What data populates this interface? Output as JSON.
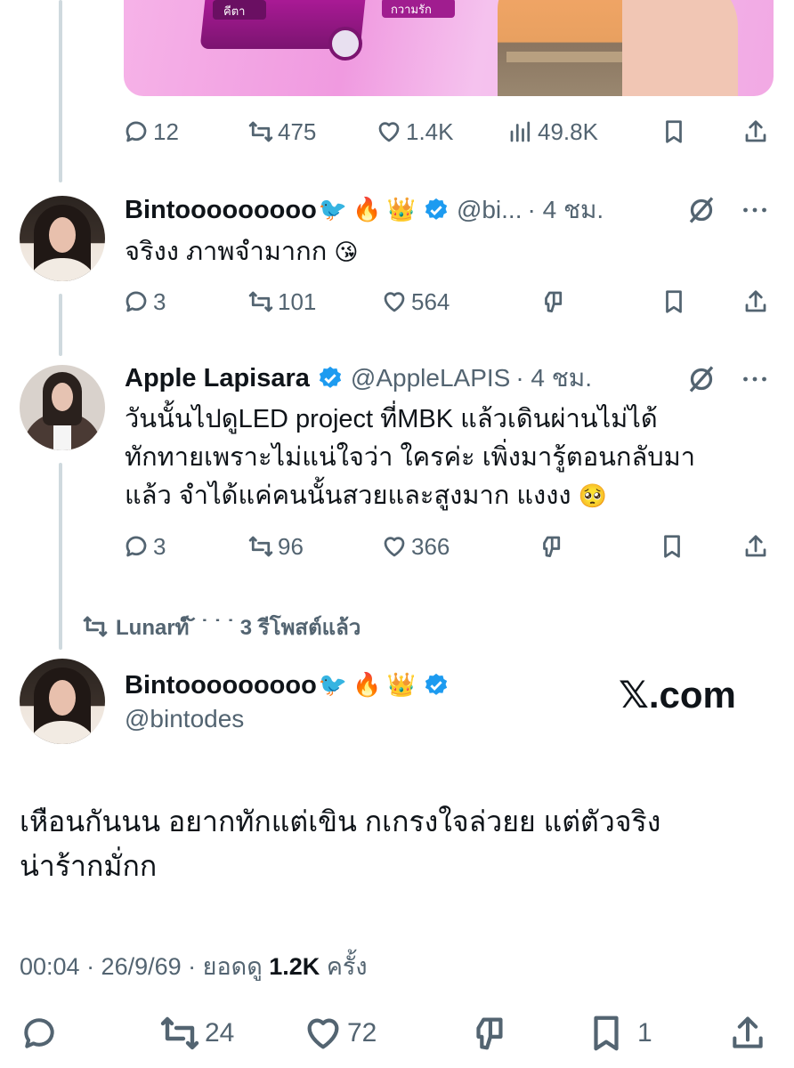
{
  "top_tweet": {
    "stats": {
      "replies": "12",
      "reposts": "475",
      "likes": "1.4K",
      "views": "49.8K"
    },
    "media_text": {
      "tag1": "คีตา",
      "tag2": "กวามรัก"
    }
  },
  "reply_bin": {
    "name": "Bintooooooooo",
    "emoji_1": "🐦",
    "emoji_2": "🔥",
    "emoji_3": "👑",
    "handle": "@bi...",
    "time": "· 4 ชม.",
    "text": "จริงง ภาพจำมากก",
    "text_emoji": "😘",
    "stats": {
      "replies": "3",
      "reposts": "101",
      "likes": "564"
    }
  },
  "reply_apple": {
    "name": "Apple Lapisara",
    "handle": "@AppleLAPIS",
    "time": "· 4 ชม.",
    "lines": [
      "วันนั้นไปดูLED project ที่MBK แล้วเดินผ่านไม่ได้",
      "ทักทายเพราะไม่แน่ใจว่า ใครค่ะ เพิ่งมารู้ตอนกลับมา",
      "แล้ว จำได้แค่คนนั้นสวยและสูงมาก แงงง"
    ],
    "text_emoji": "🥺",
    "stats": {
      "replies": "3",
      "reposts": "96",
      "likes": "366"
    }
  },
  "repost_banner": {
    "text": "Lunarท์ ໌ ˙ ˙ ˙ 3 รีโพสต์แล้ว"
  },
  "main_tweet": {
    "name": "Bintooooooooo",
    "emoji_1": "🐦",
    "emoji_2": "🔥",
    "emoji_3": "👑",
    "handle": "@bintodes",
    "watermark": "𝕏.com",
    "lines": [
      "เหือนกันนน อยากทักแต่เขิน กเกรงใจล่วยย แต่ตัวจริง",
      "น่าร้ากมั่กก"
    ],
    "meta_prefix": "00:04 · 26/9/69 · ยอดดู",
    "meta_views": "1.2K",
    "meta_suffix": "ครั้ง",
    "stats": {
      "reposts": "24",
      "likes": "72",
      "bookmarks": "1"
    }
  },
  "colors": {
    "verified": "#1d9bf0",
    "secondary": "#536471",
    "thread_line": "#cfd9de"
  }
}
